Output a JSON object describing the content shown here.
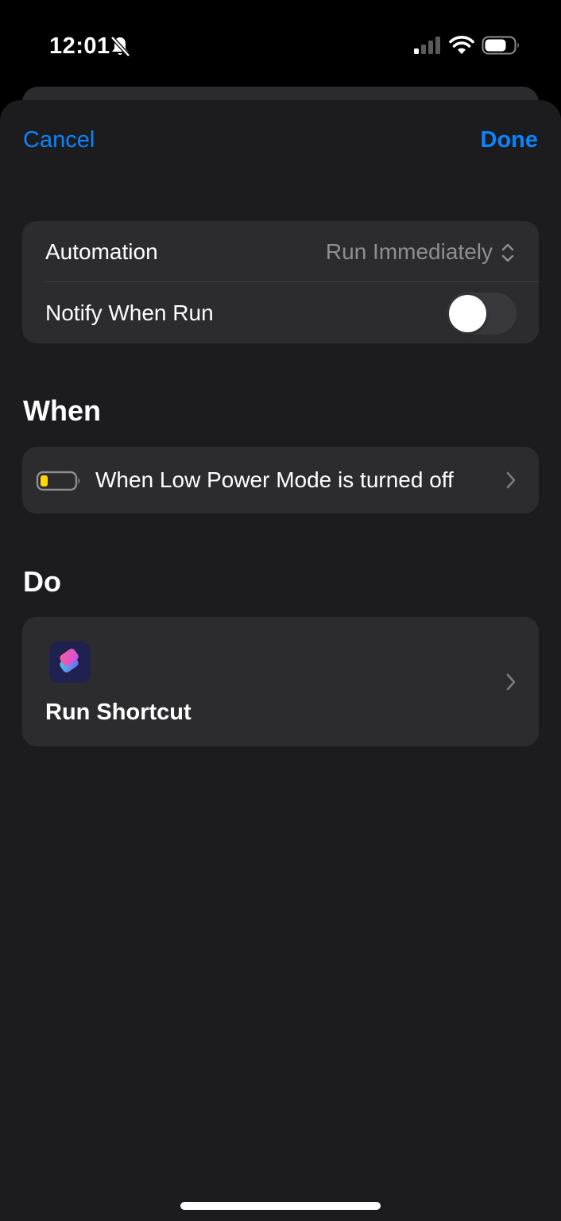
{
  "status_bar": {
    "time": "12:01",
    "icons": [
      "bell-slash-icon",
      "signal-icon",
      "wifi-icon",
      "battery-icon"
    ]
  },
  "nav": {
    "cancel_label": "Cancel",
    "done_label": "Done"
  },
  "settings": {
    "automation_label": "Automation",
    "automation_value": "Run Immediately",
    "notify_label": "Notify When Run",
    "notify_enabled": false
  },
  "when": {
    "heading": "When",
    "trigger_label": "When Low Power Mode is turned off",
    "trigger_icon": "battery-low-icon"
  },
  "do": {
    "heading": "Do",
    "action_label": "Run Shortcut",
    "action_icon": "shortcuts-app-icon"
  },
  "colors": {
    "accent": "#0a84ff",
    "sheet_background": "#1c1c1e",
    "group_background": "#2c2c2e",
    "secondary_text": "#8e8e93",
    "battery_fill": "#ffd60a"
  }
}
